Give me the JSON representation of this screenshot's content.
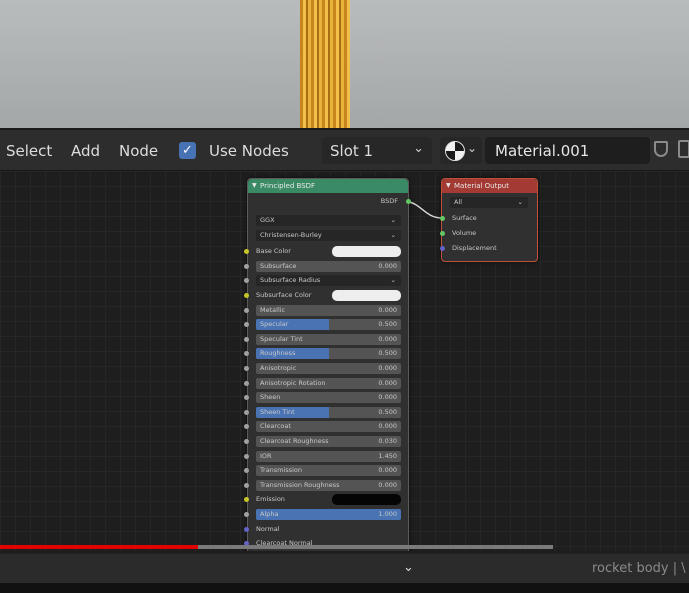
{
  "header": {
    "menus": [
      "Select",
      "Add",
      "Node"
    ],
    "use_nodes_label": "Use Nodes",
    "use_nodes_checked": true,
    "slot": "Slot 1",
    "material_name": "Material.001"
  },
  "bsdf_node": {
    "title": "Principled BSDF",
    "output_label": "BSDF",
    "distribution": "GGX",
    "subsurface_method": "Christensen-Burley",
    "subsurface_radius_label": "Subsurface Radius",
    "inputs": [
      {
        "label": "Base Color",
        "type": "color",
        "color": "#eeeeee"
      },
      {
        "label": "Subsurface",
        "value": "0.000"
      },
      {
        "label": "Subsurface Radius",
        "type": "dropdown"
      },
      {
        "label": "Subsurface Color",
        "type": "color",
        "color": "#eeeeee"
      },
      {
        "label": "Metallic",
        "value": "0.000"
      },
      {
        "label": "Specular",
        "value": "0.500",
        "fill": 0.5
      },
      {
        "label": "Specular Tint",
        "value": "0.000"
      },
      {
        "label": "Roughness",
        "value": "0.500",
        "fill": 0.5
      },
      {
        "label": "Anisotropic",
        "value": "0.000"
      },
      {
        "label": "Anisotropic Rotation",
        "value": "0.000"
      },
      {
        "label": "Sheen",
        "value": "0.000"
      },
      {
        "label": "Sheen Tint",
        "value": "0.500",
        "fill": 0.5
      },
      {
        "label": "Clearcoat",
        "value": "0.000"
      },
      {
        "label": "Clearcoat Roughness",
        "value": "0.030"
      },
      {
        "label": "IOR",
        "value": "1.450"
      },
      {
        "label": "Transmission",
        "value": "0.000"
      },
      {
        "label": "Transmission Roughness",
        "value": "0.000"
      },
      {
        "label": "Emission",
        "type": "color",
        "color": "#050505"
      },
      {
        "label": "Alpha",
        "value": "1.000",
        "fill": 1.0
      },
      {
        "label": "Normal",
        "type": "plain"
      },
      {
        "label": "Clearcoat Normal",
        "type": "plain"
      }
    ]
  },
  "output_node": {
    "title": "Material Output",
    "target": "All",
    "inputs": [
      "Surface",
      "Volume",
      "Displacement"
    ]
  },
  "video": {
    "progress": 0.358,
    "buffered": 1.0
  },
  "status": {
    "text": "rocket body | \\"
  },
  "colors": {
    "bsdf_header": "#3a8b65",
    "output_header": "#a33a33",
    "accent": "#4772b3",
    "progress": "#e00000"
  }
}
